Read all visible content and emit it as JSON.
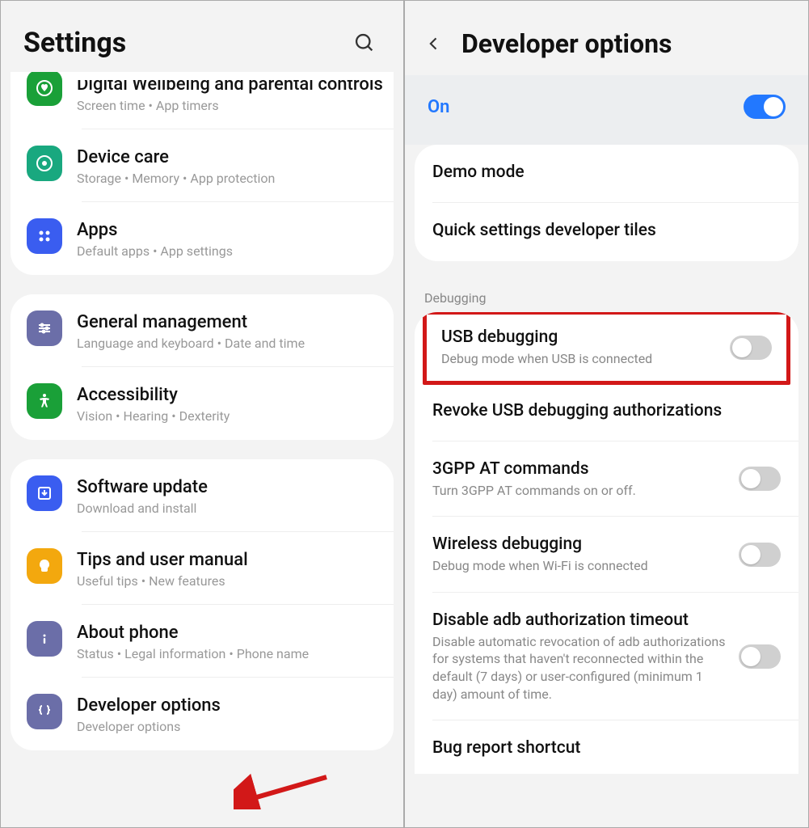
{
  "left": {
    "title": "Settings",
    "groups": [
      {
        "items": [
          {
            "id": "wellbeing",
            "icon": "heart",
            "color": "#1aa038",
            "title": "Digital Wellbeing and parental controls",
            "sub": "Screen time  •  App timers",
            "cut": true
          },
          {
            "id": "devicecare",
            "icon": "care",
            "color": "#19a87f",
            "title": "Device care",
            "sub": "Storage  •  Memory  •  App protection"
          },
          {
            "id": "apps",
            "icon": "grid",
            "color": "#3a5df0",
            "title": "Apps",
            "sub": "Default apps  •  App settings"
          }
        ]
      },
      {
        "items": [
          {
            "id": "general",
            "icon": "sliders",
            "color": "#6b6ea8",
            "title": "General management",
            "sub": "Language and keyboard  •  Date and time"
          },
          {
            "id": "accessibility",
            "icon": "accessibility",
            "color": "#1aa038",
            "title": "Accessibility",
            "sub": "Vision  •  Hearing  •  Dexterity"
          }
        ]
      },
      {
        "items": [
          {
            "id": "update",
            "icon": "update",
            "color": "#3a5df0",
            "title": "Software update",
            "sub": "Download and install"
          },
          {
            "id": "tips",
            "icon": "bulb",
            "color": "#f3a80e",
            "title": "Tips and user manual",
            "sub": "Useful tips  •  New features"
          },
          {
            "id": "about",
            "icon": "info",
            "color": "#6b6ea8",
            "title": "About phone",
            "sub": "Status  •  Legal information  •  Phone name"
          },
          {
            "id": "dev",
            "icon": "braces",
            "color": "#6b6ea8",
            "title": "Developer options",
            "sub": "Developer options"
          }
        ]
      }
    ]
  },
  "right": {
    "title": "Developer options",
    "master": {
      "label": "On",
      "on": true
    },
    "group1": [
      {
        "id": "demo",
        "title": "Demo mode"
      },
      {
        "id": "qstiles",
        "title": "Quick settings developer tiles"
      }
    ],
    "section_debug": "Debugging",
    "debug_items": [
      {
        "id": "usb",
        "title": "USB debugging",
        "sub": "Debug mode when USB is connected",
        "toggle": false,
        "highlight": true
      },
      {
        "id": "revoke",
        "title": "Revoke USB debugging authorizations"
      },
      {
        "id": "3gpp",
        "title": "3GPP AT commands",
        "sub": "Turn 3GPP AT commands on or off.",
        "toggle": false
      },
      {
        "id": "wireless",
        "title": "Wireless debugging",
        "sub": "Debug mode when Wi-Fi is connected",
        "toggle": false
      },
      {
        "id": "adb",
        "title": "Disable adb authorization timeout",
        "sub": "Disable automatic revocation of adb authorizations for systems that haven't reconnected within the default (7 days) or user-configured (minimum 1 day) amount of time.",
        "toggle": false
      },
      {
        "id": "bugreport",
        "title": "Bug report shortcut"
      }
    ]
  }
}
